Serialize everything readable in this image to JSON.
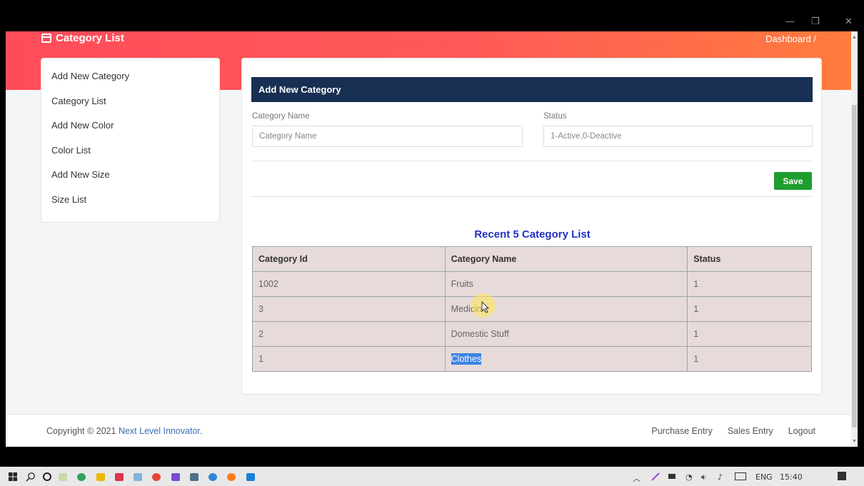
{
  "window": {
    "minimize": "—",
    "maximize": "❐",
    "close": "✕"
  },
  "header": {
    "title": "Category List",
    "breadcrumb": "Dashboard  /"
  },
  "sidebar": {
    "items": [
      {
        "label": "Add New Category"
      },
      {
        "label": "Category List"
      },
      {
        "label": "Add New Color"
      },
      {
        "label": "Color List"
      },
      {
        "label": "Add New Size"
      },
      {
        "label": "Size List"
      }
    ]
  },
  "form": {
    "card_title": "Add New Category",
    "category_name_label": "Category Name",
    "category_name_placeholder": "Category Name",
    "status_label": "Status",
    "status_placeholder": "1-Active,0-Deactive",
    "save_label": "Save"
  },
  "recent": {
    "title": "Recent 5 Category List",
    "headers": [
      "Category Id",
      "Category Name",
      "Status"
    ],
    "rows": [
      [
        "1002",
        "Fruits",
        "1"
      ],
      [
        "3",
        "Medicine",
        "1"
      ],
      [
        "2",
        "Domestic Stuff",
        "1"
      ],
      [
        "1",
        "Clothes",
        "1"
      ]
    ]
  },
  "footer": {
    "copyright_prefix": "Copyright © 2021 ",
    "company": "Next Level Innovator",
    "copyright_suffix": ".",
    "links": [
      "Purchase Entry",
      "Sales Entry",
      "Logout"
    ]
  },
  "taskbar": {
    "pinned_icons": [
      "windows-start-icon",
      "search-icon",
      "cortana-icon",
      "snipping-icon",
      "clock-icon",
      "file-explorer-icon",
      "shield-icon",
      "paint-icon",
      "chrome-icon",
      "visual-studio-icon",
      "calculator-icon",
      "edge-icon",
      "firefox-icon",
      "media-player-icon"
    ],
    "language": "ENG",
    "time": "15:40"
  },
  "colors": {
    "header_from": "#ff4c5b",
    "header_to": "#ff7c3d",
    "card_head": "#172f52",
    "save": "#1f9d2e",
    "accent_title": "#2031c4"
  }
}
